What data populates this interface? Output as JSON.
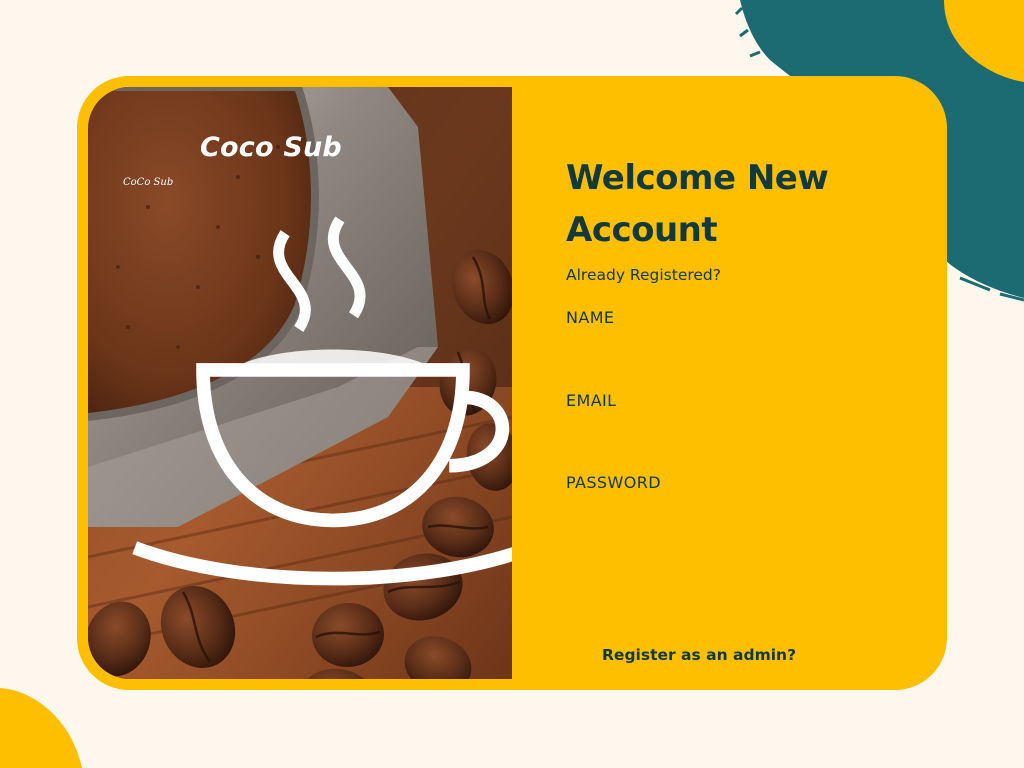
{
  "brand": {
    "name": "Coco Sub",
    "logo_text": "CoCo Sub",
    "logo_icon": "coffee-cup-icon"
  },
  "form": {
    "title_line1": "Welcome New",
    "title_line2": "Account",
    "login_link": "Already Registered?",
    "name_label": "NAME",
    "email_label": "EMAIL",
    "password_label": "PASSWORD",
    "admin_link": "Register as an admin?"
  },
  "colors": {
    "background": "#fdf7ee",
    "card": "#fdbf00",
    "accent_teal": "#1c6b73",
    "text_dark": "#12393b",
    "brand_text": "#ffffff"
  }
}
